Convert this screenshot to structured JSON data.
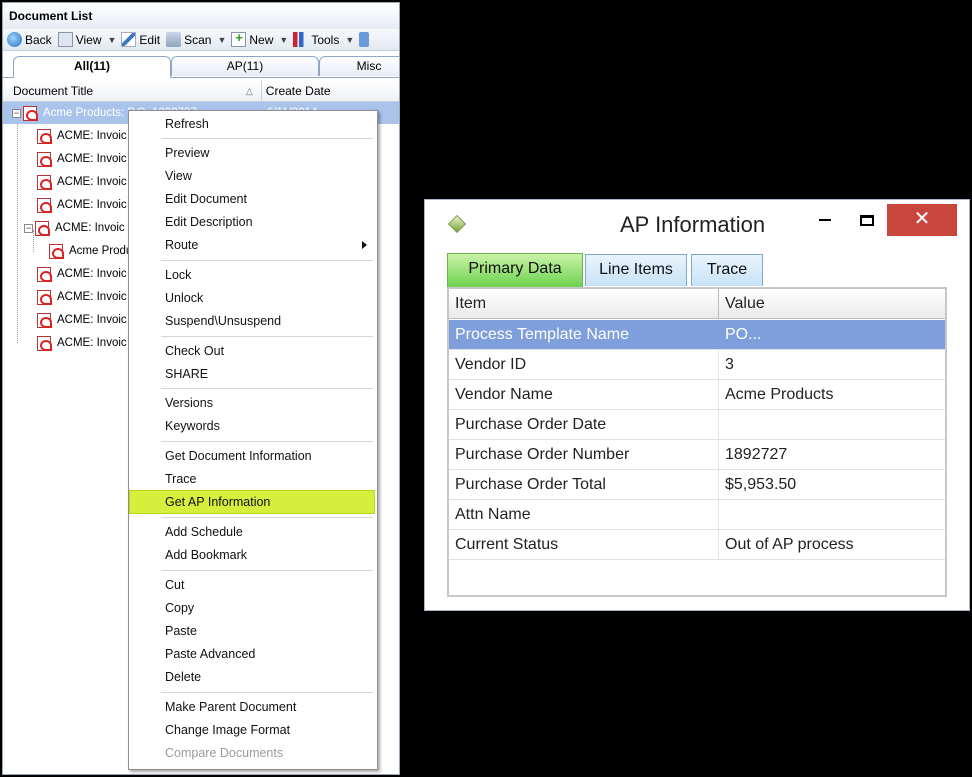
{
  "doclist": {
    "title": "Document List",
    "toolbar": {
      "back": "Back",
      "view": "View",
      "edit": "Edit",
      "scan": "Scan",
      "new": "New",
      "tools": "Tools"
    },
    "tabs": [
      "All(11)",
      "AP(11)",
      "Misc"
    ],
    "columns": {
      "title": "Document Title",
      "date": "Create Date"
    },
    "rows": [
      {
        "title": "Acme Products: P.O. 1892727",
        "date": "6/11/2014"
      },
      {
        "title": "ACME: Invoic"
      },
      {
        "title": "ACME: Invoic"
      },
      {
        "title": "ACME: Invoic"
      },
      {
        "title": "ACME: Invoic"
      },
      {
        "title": "ACME: Invoic"
      },
      {
        "title": "Acme Produ"
      },
      {
        "title": "ACME: Invoic"
      },
      {
        "title": "ACME: Invoic"
      },
      {
        "title": "ACME: Invoic"
      },
      {
        "title": "ACME: Invoic"
      }
    ]
  },
  "context_menu": {
    "items": [
      "Refresh",
      "Preview",
      "View",
      "Edit Document",
      "Edit Description",
      "Route",
      "Lock",
      "Unlock",
      "Suspend\\Unsuspend",
      "Check Out",
      "SHARE",
      "Versions",
      "Keywords",
      "Get Document Information",
      "Trace",
      "Get AP Information",
      "Add Schedule",
      "Add Bookmark",
      "Cut",
      "Copy",
      "Paste",
      "Paste Advanced",
      "Delete",
      "Make Parent Document",
      "Change Image Format",
      "Compare Documents"
    ],
    "highlight_color": "#d6ef3c"
  },
  "ap_dialog": {
    "title": "AP Information",
    "close_glyph": "✕",
    "tabs": [
      "Primary Data",
      "Line Items",
      "Trace"
    ],
    "headers": {
      "item": "Item",
      "value": "Value"
    },
    "rows": [
      {
        "item": "Process Template Name",
        "value": "PO..."
      },
      {
        "item": "Vendor ID",
        "value": "3"
      },
      {
        "item": "Vendor Name",
        "value": "Acme Products"
      },
      {
        "item": "Purchase Order Date",
        "value": ""
      },
      {
        "item": "Purchase Order Number",
        "value": "1892727"
      },
      {
        "item": "Purchase Order Total",
        "value": "$5,953.50"
      },
      {
        "item": "Attn Name",
        "value": ""
      },
      {
        "item": "Current Status",
        "value": "Out of AP process"
      }
    ]
  }
}
